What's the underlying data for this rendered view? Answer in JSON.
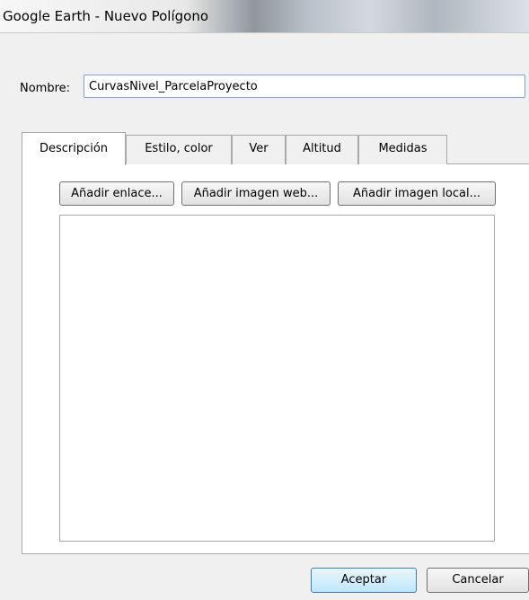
{
  "window": {
    "title": "Google Earth - Nuevo Polígono"
  },
  "form": {
    "name_label": "Nombre:",
    "name_value": "CurvasNivel_ParcelaProyecto"
  },
  "tabs": [
    {
      "label": "Descripción",
      "active": true
    },
    {
      "label": "Estilo, color",
      "active": false
    },
    {
      "label": "Ver",
      "active": false
    },
    {
      "label": "Altitud",
      "active": false
    },
    {
      "label": "Medidas",
      "active": false
    }
  ],
  "description": {
    "add_link_label": "Añadir enlace...",
    "add_web_image_label": "Añadir imagen web...",
    "add_local_image_label": "Añadir imagen local...",
    "text": ""
  },
  "footer": {
    "ok_label": "Aceptar",
    "cancel_label": "Cancelar"
  }
}
